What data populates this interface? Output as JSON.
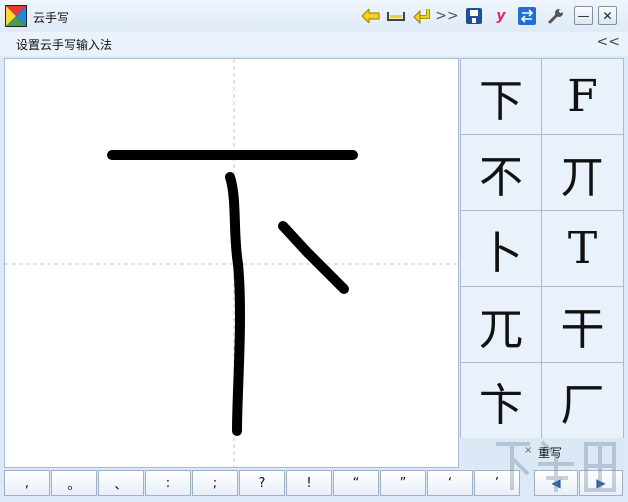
{
  "app": {
    "title": "云手写"
  },
  "toolbar": {
    "icons": [
      "back-arrow-icon",
      "space-icon",
      "enter-icon",
      "double-chevron-icon",
      "save-icon",
      "youdao-icon",
      "switch-icon",
      "wrench-icon"
    ],
    "double_chevron_glyph": ">>",
    "youdao_glyph": "y"
  },
  "window": {
    "minimize_glyph": "—",
    "close_glyph": "✕"
  },
  "menu": {
    "setup_label": "设置云手写输入法",
    "collapse_glyph": "<<"
  },
  "candidates": [
    "下",
    "F",
    "不",
    "丌",
    "卜",
    "T",
    "兀",
    "干",
    "卞",
    "厂"
  ],
  "rewrite": {
    "x_glyph": "×",
    "label": "重写"
  },
  "punctuation": [
    ",",
    "。",
    "、",
    ":",
    ";",
    "?",
    "!",
    "“",
    "”",
    "‘",
    "’"
  ],
  "nav": {
    "prev_glyph": "◀",
    "next_glyph": "▶"
  },
  "colors": {
    "ink": "#000000",
    "accent": "#2a5ea8"
  }
}
